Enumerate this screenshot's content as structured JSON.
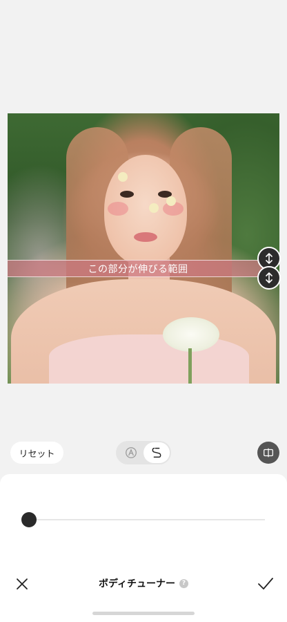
{
  "editor": {
    "stretch_label": "この部分が伸びる範囲",
    "reset_label": "リセット",
    "tool_title": "ボディチューナー",
    "help_symbol": "?"
  },
  "slider": {
    "value": 0
  },
  "mode_toggle": {
    "options": [
      "auto-icon",
      "manual-icon"
    ],
    "selected": "manual-icon"
  },
  "icons": {
    "handle_top": "vertical-resize-icon",
    "handle_bottom": "vertical-resize-icon",
    "compare": "compare-icon",
    "cancel": "close-icon",
    "confirm": "checkmark-icon"
  },
  "colors": {
    "band": "#cd7882",
    "handle": "#2c2c2c",
    "thumb": "#2a2a2a"
  }
}
